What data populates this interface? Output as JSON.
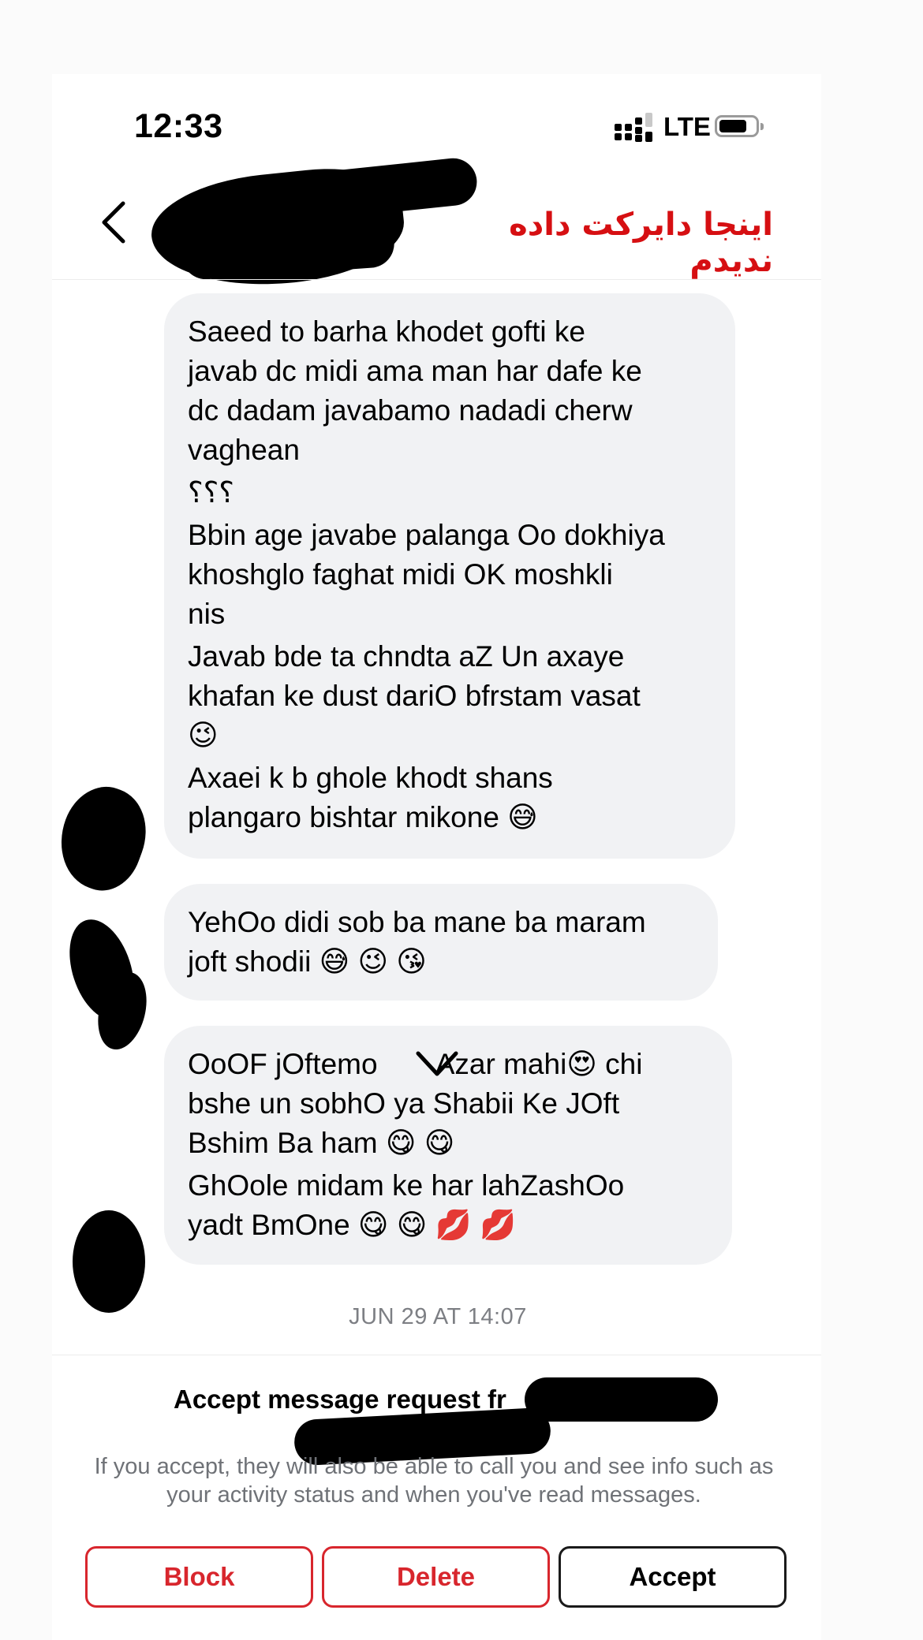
{
  "status_bar": {
    "time": "12:33",
    "network": "LTE"
  },
  "header": {
    "annotation": "اینجا دایرکت داده ندیدم",
    "annotation_color": "#d60f12"
  },
  "messages": [
    {
      "paragraphs": [
        "Saeed to barha khodet gofti ke\njavab dc midi ama man har dafe ke\ndc dadam javabamo nadadi cherw\nvaghean",
        "؟؟؟",
        "Bbin age javabe palanga Oo dokhiya\nkhoshglo faghat midi OK moshkli\nnis",
        "Javab bde ta chndta aZ Un axaye\nkhafan ke dust dariO bfrstam vasat\n😉",
        "Axaei k b ghole khodt shans\nplangaro bishtar mikone 😅"
      ]
    },
    {
      "paragraphs": [
        "YehOo didi sob ba mane ba maram\njoft shodii 😅 😉 😘"
      ]
    },
    {
      "paragraphs": [
        "OoOF jOftemo     Azar mahi😍 chi\nbshe un sobhO ya Shabii Ke JOft\nBshim Ba ham 😋 😋",
        "GhOole midam ke har lahZashOo\nyadt BmOne 😋 😋 💋 💋"
      ]
    }
  ],
  "timestamp": "JUN 29 AT 14:07",
  "request": {
    "title": "Accept message request fr",
    "info": "If you accept, they will also be able to call you and see info such as your activity status and when you've read messages."
  },
  "actions": {
    "block": "Block",
    "delete": "Delete",
    "accept": "Accept",
    "destructive_color": "#d8262d"
  },
  "icons": {
    "back": "chevron-left-icon",
    "scroll": "chevron-down-icon",
    "signal": "signal-icon",
    "battery": "battery-icon"
  }
}
